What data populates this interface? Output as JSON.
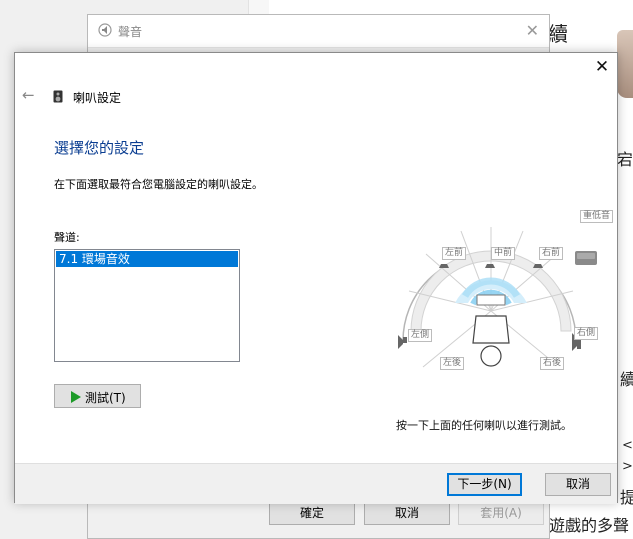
{
  "background_window": {
    "title": "聲音",
    "buttons": {
      "ok": "確定",
      "cancel": "取消",
      "apply": "套用(A)"
    }
  },
  "background_page": {
    "fragments": [
      "續",
      "宕",
      "續",
      "<",
      ">",
      "提",
      "遊戲的多聲"
    ]
  },
  "dialog": {
    "title": "喇叭設定",
    "heading": "選擇您的設定",
    "description": "在下面選取最符合您電腦設定的喇叭設定。",
    "channels_label": "聲道:",
    "channels": [
      "7.1 環場音效"
    ],
    "selected_channel": "7.1 環場音效",
    "test_button": "測試(T)",
    "hint": "按一下上面的任何喇叭以進行測試。",
    "next_button": "下一步(N)",
    "cancel_button": "取消"
  },
  "speakers": {
    "front_left": "左前",
    "center": "中前",
    "front_right": "右前",
    "subwoofer": "重低音",
    "side_left": "左側",
    "side_right": "右側",
    "rear_left": "左後",
    "rear_right": "右後"
  },
  "colors": {
    "accent": "#0078d7",
    "heading": "#0a3d91",
    "play_icon": "#1d9a28"
  }
}
